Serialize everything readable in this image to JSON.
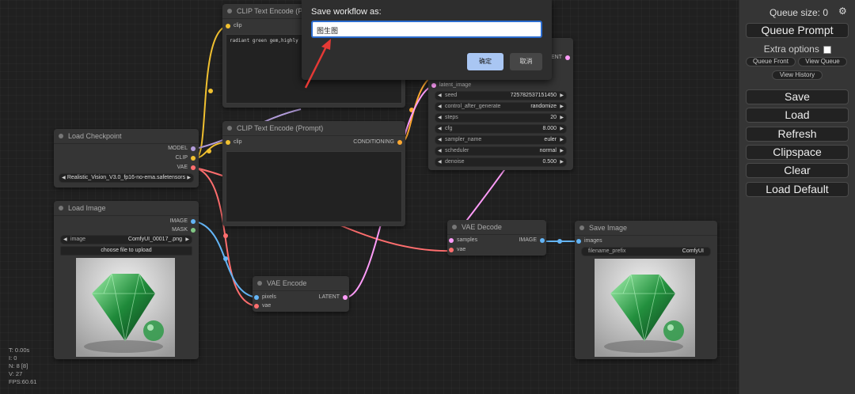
{
  "dialog": {
    "title": "Save workflow as:",
    "input_value": "图生图",
    "ok_label": "确定",
    "cancel_label": "取消"
  },
  "menu": {
    "queue_size": "Queue size: 0",
    "settings_icon": "gear-icon",
    "queue_prompt": "Queue Prompt",
    "extra_options": "Extra options",
    "extra_options_checked": false,
    "queue_front": "Queue Front",
    "view_queue": "View Queue",
    "view_history": "View History",
    "save": "Save",
    "load": "Load",
    "refresh": "Refresh",
    "clipspace": "Clipspace",
    "clear": "Clear",
    "load_default": "Load Default"
  },
  "nodes": {
    "clip_top": {
      "title": "CLIP Text Encode (Prompt)",
      "input_clip": "clip",
      "text": "radiant green gem,highly"
    },
    "clip_mid": {
      "title": "CLIP Text Encode (Prompt)",
      "input_clip": "clip",
      "output": "CONDITIONING"
    },
    "load_checkpoint": {
      "title": "Load Checkpoint",
      "out_model": "MODEL",
      "out_clip": "CLIP",
      "out_vae": "VAE",
      "ckpt_value": "Realistic_Vision_V3.0_fp16-no-ema.safetensors"
    },
    "load_image": {
      "title": "Load Image",
      "out_image": "IMAGE",
      "out_mask": "MASK",
      "image_label": "image",
      "image_value": "ComfyUI_00017_.png",
      "upload_label": "choose file to upload"
    },
    "ksampler": {
      "output_latent": "LATENT",
      "input_latent": "latent_image",
      "widgets": [
        {
          "label": "seed",
          "value": "725782537151450"
        },
        {
          "label": "control_after_generate",
          "value": "randomize"
        },
        {
          "label": "steps",
          "value": "20"
        },
        {
          "label": "cfg",
          "value": "8.000"
        },
        {
          "label": "sampler_name",
          "value": "euler"
        },
        {
          "label": "scheduler",
          "value": "normal"
        },
        {
          "label": "denoise",
          "value": "0.500"
        }
      ]
    },
    "vae_encode": {
      "title": "VAE Encode",
      "in_pixels": "pixels",
      "in_vae": "vae",
      "output": "LATENT"
    },
    "vae_decode": {
      "title": "VAE Decode",
      "in_samples": "samples",
      "in_vae": "vae",
      "output": "IMAGE"
    },
    "save_image": {
      "title": "Save Image",
      "in_images": "images",
      "prefix_label": "filename_prefix",
      "prefix_value": "ComfyUI"
    }
  },
  "stats": {
    "t": "T: 0.00s",
    "i": "I: 0",
    "n": "N: 8 [8]",
    "v": "V: 27",
    "fps": "FPS:60.61"
  },
  "colors": {
    "clip": "#f0c030",
    "model": "#b39ddb",
    "vae": "#ff6e6e",
    "image": "#64b5f6",
    "latent": "#ff9cf9",
    "conditioning": "#ffa931",
    "accent": "#2b6ccf"
  }
}
